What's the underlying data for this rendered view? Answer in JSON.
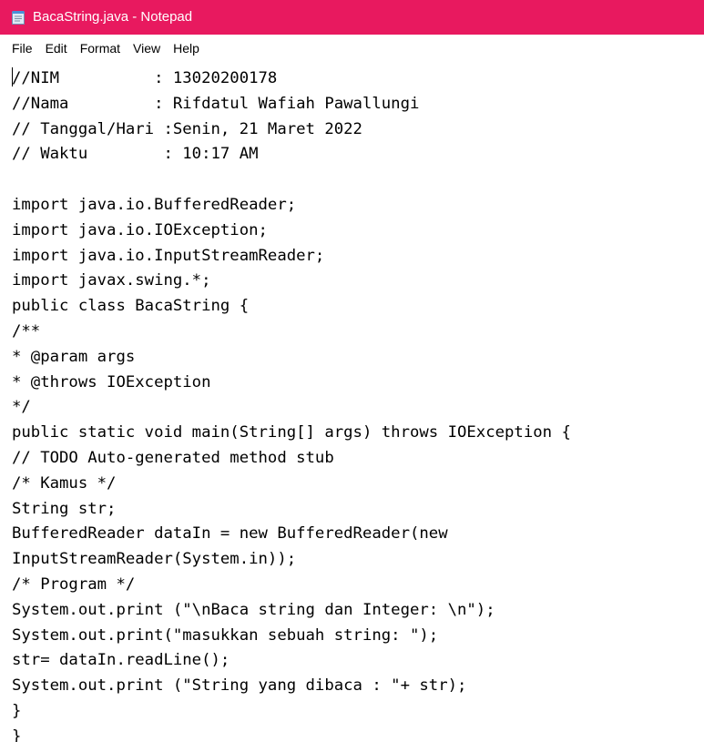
{
  "window": {
    "title": "BacaString.java - Notepad",
    "title_bar_color": "#e8195f",
    "icon": "notepad-icon"
  },
  "menu": {
    "items": [
      "File",
      "Edit",
      "Format",
      "View",
      "Help"
    ]
  },
  "editor": {
    "lines": [
      "//NIM          : 13020200178",
      "//Nama         : Rifdatul Wafiah Pawallungi",
      "// Tanggal/Hari :Senin, 21 Maret 2022",
      "// Waktu        : 10:17 AM",
      "",
      "import java.io.BufferedReader;",
      "import java.io.IOException;",
      "import java.io.InputStreamReader;",
      "import javax.swing.*;",
      "public class BacaString {",
      "/**",
      "* @param args",
      "* @throws IOException",
      "*/",
      "public static void main(String[] args) throws IOException {",
      "// TODO Auto-generated method stub",
      "/* Kamus */",
      "String str;",
      "BufferedReader dataIn = new BufferedReader(new",
      "InputStreamReader(System.in));",
      "/* Program */",
      "System.out.print (\"\\nBaca string dan Integer: \\n\");",
      "System.out.print(\"masukkan sebuah string: \");",
      "str= dataIn.readLine();",
      "System.out.print (\"String yang dibaca : \"+ str);",
      "}",
      "}"
    ]
  }
}
